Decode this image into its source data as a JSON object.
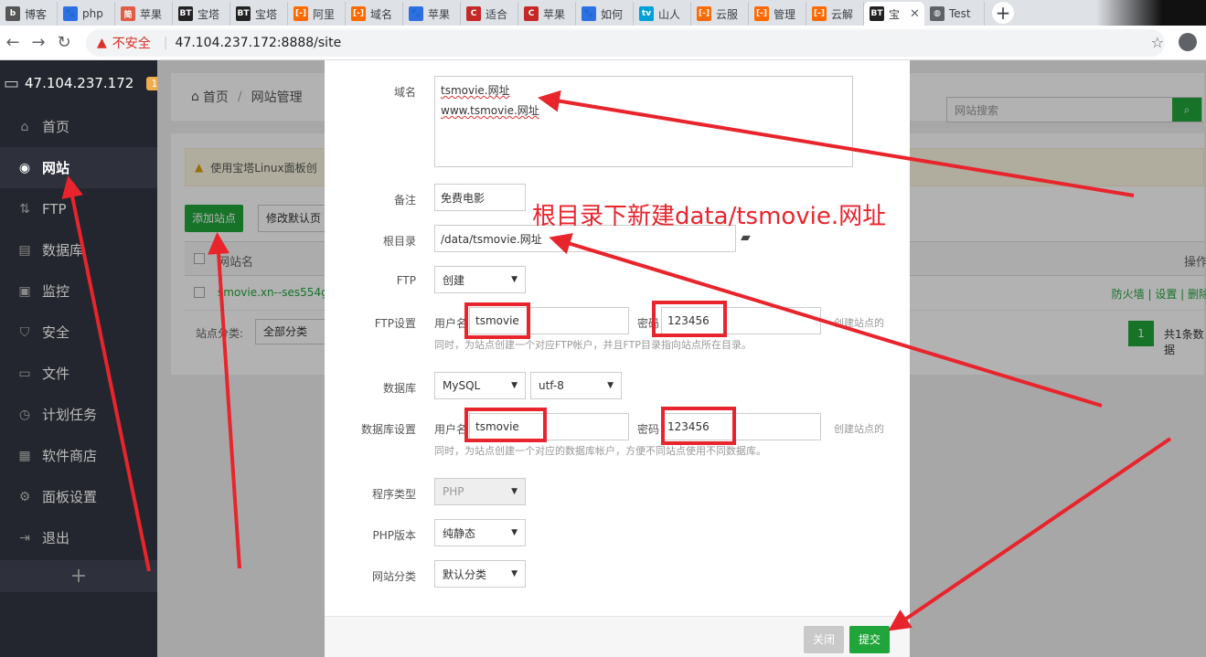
{
  "browser": {
    "tabs": [
      {
        "label": "博客",
        "icon_text": "b",
        "icon_color": "#555"
      },
      {
        "label": "php",
        "icon_text": "🐾",
        "icon_color": "#2f6fe4"
      },
      {
        "label": "苹果",
        "icon_text": "简",
        "icon_color": "#e25b45"
      },
      {
        "label": "宝塔",
        "icon_text": "BT",
        "icon_color": "#222"
      },
      {
        "label": "宝塔",
        "icon_text": "BT",
        "icon_color": "#222"
      },
      {
        "label": "阿里",
        "icon_text": "[-]",
        "icon_color": "#ff6a00"
      },
      {
        "label": "域名",
        "icon_text": "[-]",
        "icon_color": "#ff6a00"
      },
      {
        "label": "苹果",
        "icon_text": "🐾",
        "icon_color": "#2f6fe4"
      },
      {
        "label": "适合",
        "icon_text": "C",
        "icon_color": "#c62828"
      },
      {
        "label": "苹果",
        "icon_text": "C",
        "icon_color": "#c62828"
      },
      {
        "label": "如何",
        "icon_text": "🐾",
        "icon_color": "#2f6fe4"
      },
      {
        "label": "山人",
        "icon_text": "tv",
        "icon_color": "#00a1d6"
      },
      {
        "label": "云服",
        "icon_text": "[-]",
        "icon_color": "#ff6a00"
      },
      {
        "label": "管理",
        "icon_text": "[-]",
        "icon_color": "#ff6a00"
      },
      {
        "label": "云解",
        "icon_text": "[-]",
        "icon_color": "#ff6a00"
      },
      {
        "label": "宝",
        "icon_text": "BT",
        "icon_color": "#222",
        "active": true
      },
      {
        "label": "Test",
        "icon_text": "◍",
        "icon_color": "#5f6368"
      }
    ],
    "not_secure": "不安全",
    "url": "47.104.237.172:8888/site"
  },
  "sidebar": {
    "host": "47.104.237.172",
    "badge": "1",
    "items": [
      {
        "label": "首页",
        "icon": "home-icon",
        "glyph": "⌂"
      },
      {
        "label": "网站",
        "icon": "globe-icon",
        "glyph": "◉",
        "active": true
      },
      {
        "label": "FTP",
        "icon": "ftp-icon",
        "glyph": "⇅"
      },
      {
        "label": "数据库",
        "icon": "database-icon",
        "glyph": "▤"
      },
      {
        "label": "监控",
        "icon": "monitor-icon",
        "glyph": "▣"
      },
      {
        "label": "安全",
        "icon": "shield-icon",
        "glyph": "⛉"
      },
      {
        "label": "文件",
        "icon": "folder-icon",
        "glyph": "▭"
      },
      {
        "label": "计划任务",
        "icon": "clock-icon",
        "glyph": "◷"
      },
      {
        "label": "软件商店",
        "icon": "apps-icon",
        "glyph": "▦"
      },
      {
        "label": "面板设置",
        "icon": "gear-icon",
        "glyph": "⚙"
      },
      {
        "label": "退出",
        "icon": "logout-icon",
        "glyph": "⇥"
      }
    ],
    "plus": "+"
  },
  "main": {
    "breadcrumb_home": "首页",
    "breadcrumb_sep": "/",
    "breadcrumb_current": "网站管理",
    "search_placeholder": "网站搜索",
    "notice": "使用宝塔Linux面板创",
    "add_site": "添加站点",
    "modify_default": "修改默认页",
    "col_site_name": "网站名",
    "col_ops": "操作",
    "row_site": "smovie.xn--ses554g",
    "row_ops": "防火墙 | 设置 | 删除",
    "category_label": "站点分类:",
    "category_value": "全部分类",
    "page_num": "1",
    "total": "共1条数据"
  },
  "modal": {
    "domain_label": "域名",
    "domain_line1": "tsmovie.网址",
    "domain_line2": "www.tsmovie.网址",
    "remark_label": "备注",
    "remark_value": "免费电影",
    "root_label": "根目录",
    "root_value": "/data/tsmovie.网址",
    "ftp_label": "FTP",
    "ftp_value": "创建",
    "ftp_settings_label": "FTP设置",
    "user_label": "用户名",
    "ftp_user": "tsmovie",
    "pwd_label": "密码",
    "ftp_pwd": "123456",
    "ftp_hint_right": "创建站点的",
    "ftp_hint": "同时，为站点创建一个对应FTP帐户，并且FTP目录指向站点所在目录。",
    "db_label": "数据库",
    "db_value": "MySQL",
    "charset_value": "utf-8",
    "db_settings_label": "数据库设置",
    "db_user": "tsmovie",
    "db_pwd": "123456",
    "db_hint_right": "创建站点的",
    "db_hint": "同时，为站点创建一个对应的数据库帐户，方便不同站点使用不同数据库。",
    "program_label": "程序类型",
    "program_value": "PHP",
    "php_label": "PHP版本",
    "php_value": "纯静态",
    "category_label": "网站分类",
    "category_value": "默认分类",
    "close_btn": "关闭",
    "submit_btn": "提交"
  },
  "annotation": "根目录下新建data/tsmovie.网址",
  "colors": {
    "accent_green": "#20a53a",
    "annotation_red": "#e8242c",
    "sidebar_bg": "#23262e"
  }
}
